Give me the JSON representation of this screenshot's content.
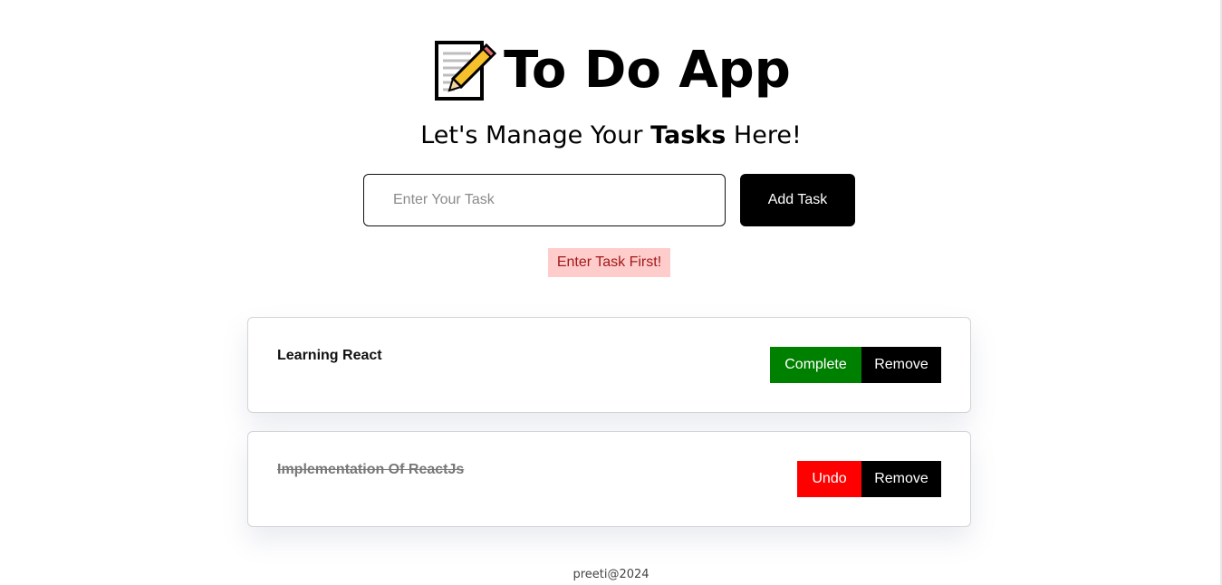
{
  "header": {
    "icon": "memo-pencil-icon",
    "title": "To Do App"
  },
  "subtitle": {
    "prefix": "Let's Manage Your ",
    "bold": "Tasks",
    "suffix": " Here!"
  },
  "form": {
    "placeholder": "Enter Your Task",
    "value": "",
    "add_label": "Add Task"
  },
  "error": {
    "message": "Enter Task First!"
  },
  "tasks": [
    {
      "name": "Learning React",
      "completed": false,
      "toggle_label": "Complete",
      "remove_label": "Remove"
    },
    {
      "name": "Implementation Of ReactJs",
      "completed": true,
      "toggle_label": "Undo",
      "remove_label": "Remove"
    }
  ],
  "footer": {
    "text": "preeti@2024"
  },
  "colors": {
    "complete": "#008000",
    "undo": "#ff0000",
    "remove": "#000000",
    "error_bg": "#ffcccc",
    "error_text": "#a31818"
  }
}
